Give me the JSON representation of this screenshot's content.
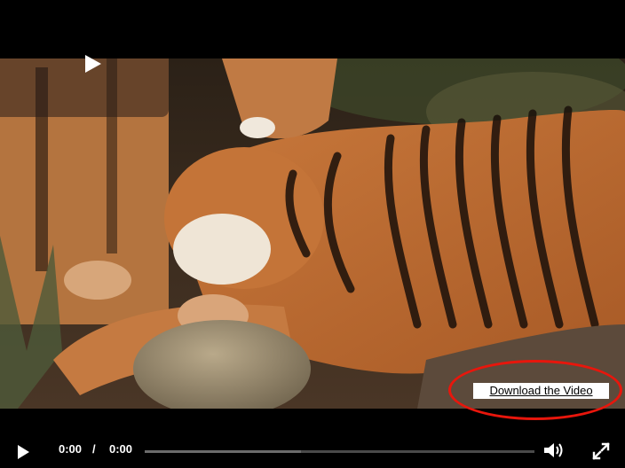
{
  "player": {
    "download_label": "Download the Video",
    "current_time": "0:00",
    "time_separator": "/",
    "duration": "0:00",
    "buffered_fraction": 0.4,
    "accent_color": "#e8160c"
  },
  "icons": {
    "big_play": "play-icon",
    "play": "play-icon",
    "volume": "volume-icon",
    "fullscreen": "fullscreen-icon"
  }
}
